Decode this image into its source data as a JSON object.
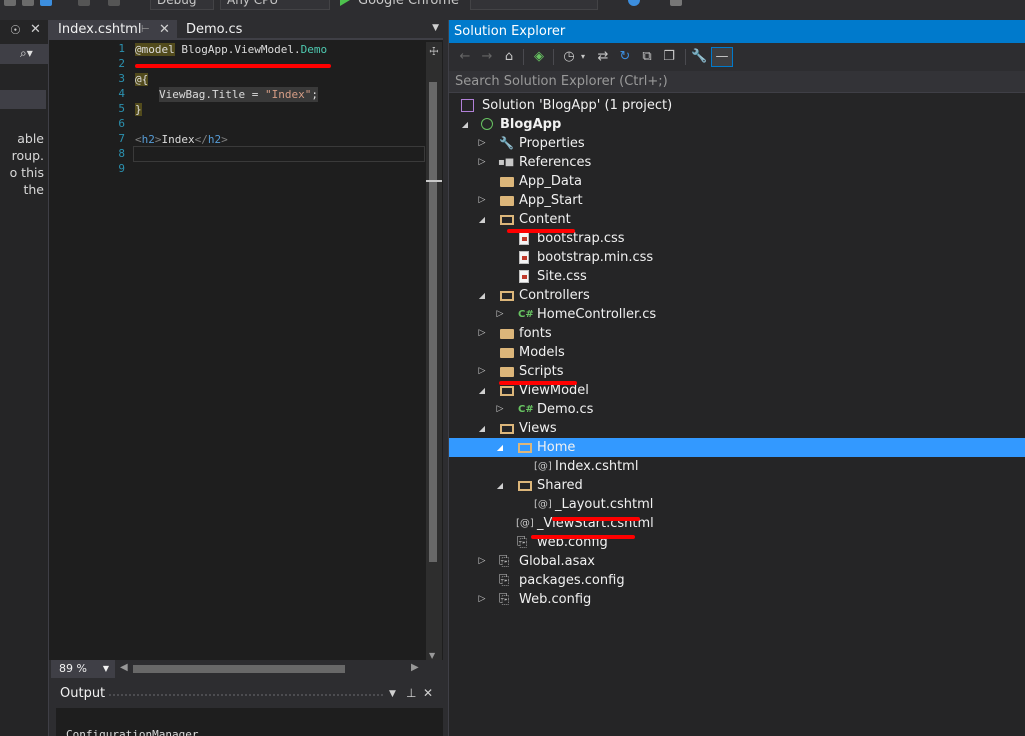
{
  "toolbar": {
    "config_value": "Debug",
    "platform_value": "Any CPU",
    "run_target": "Google Chrome"
  },
  "left_panel": {
    "text_lines": [
      "able",
      "roup.",
      "o this",
      "the"
    ]
  },
  "editor": {
    "tabs": [
      {
        "label": "Index.cshtml",
        "active": true
      },
      {
        "label": "Demo.cs",
        "active": false
      }
    ],
    "line_numbers": [
      "1",
      "2",
      "3",
      "4",
      "5",
      "6",
      "7",
      "8",
      "9"
    ],
    "code": {
      "l1_directive": "@model",
      "l1_ns": "BlogApp.ViewModel.",
      "l1_type": "Demo",
      "l3": "@{",
      "l4_prop": "ViewBag.Title = ",
      "l4_str": "\"Index\"",
      "l4_end": ";",
      "l5": "}",
      "l7_open_lt": "<",
      "l7_open_tag": "h2",
      "l7_open_gt": ">",
      "l7_text": "Index",
      "l7_close_lt": "</",
      "l7_close_tag": "h2",
      "l7_close_gt": ">"
    },
    "zoom": "89 %"
  },
  "output": {
    "title": "Output",
    "visible_text": "ConfigurationManager."
  },
  "solution_explorer": {
    "title": "Solution Explorer",
    "search_placeholder": "Search Solution Explorer (Ctrl+;)",
    "selected_item": "Home",
    "tree": [
      {
        "label": "Solution 'BlogApp' (1 project)",
        "icon": "solution-icon"
      },
      {
        "label": "BlogApp",
        "icon": "project-icon"
      },
      {
        "label": "Properties",
        "icon": "wrench-icon"
      },
      {
        "label": "References",
        "icon": "references-icon"
      },
      {
        "label": "App_Data",
        "icon": "folder-icon"
      },
      {
        "label": "App_Start",
        "icon": "folder-icon"
      },
      {
        "label": "Content",
        "icon": "folder-open-icon"
      },
      {
        "label": "bootstrap.css",
        "icon": "css-file-icon"
      },
      {
        "label": "bootstrap.min.css",
        "icon": "css-file-icon"
      },
      {
        "label": "Site.css",
        "icon": "css-file-icon"
      },
      {
        "label": "Controllers",
        "icon": "folder-open-icon"
      },
      {
        "label": "HomeController.cs",
        "icon": "csharp-file-icon"
      },
      {
        "label": "fonts",
        "icon": "folder-icon"
      },
      {
        "label": "Models",
        "icon": "folder-icon"
      },
      {
        "label": "Scripts",
        "icon": "folder-icon"
      },
      {
        "label": "ViewModel",
        "icon": "folder-open-icon"
      },
      {
        "label": "Demo.cs",
        "icon": "csharp-file-icon"
      },
      {
        "label": "Views",
        "icon": "folder-open-icon"
      },
      {
        "label": "Home",
        "icon": "folder-open-icon"
      },
      {
        "label": "Index.cshtml",
        "icon": "razor-file-icon"
      },
      {
        "label": "Shared",
        "icon": "folder-open-icon"
      },
      {
        "label": "_Layout.cshtml",
        "icon": "razor-file-icon"
      },
      {
        "label": "_ViewStart.cshtml",
        "icon": "razor-file-icon"
      },
      {
        "label": "web.config",
        "icon": "config-file-icon"
      },
      {
        "label": "Global.asax",
        "icon": "config-file-icon"
      },
      {
        "label": "packages.config",
        "icon": "config-file-icon"
      },
      {
        "label": "Web.config",
        "icon": "config-file-icon"
      }
    ]
  },
  "colors": {
    "accent": "#007acc",
    "selection": "#3399ff",
    "annotation": "#ff0000",
    "editor_bg": "#1e1e1e",
    "panel_bg": "#252526"
  }
}
